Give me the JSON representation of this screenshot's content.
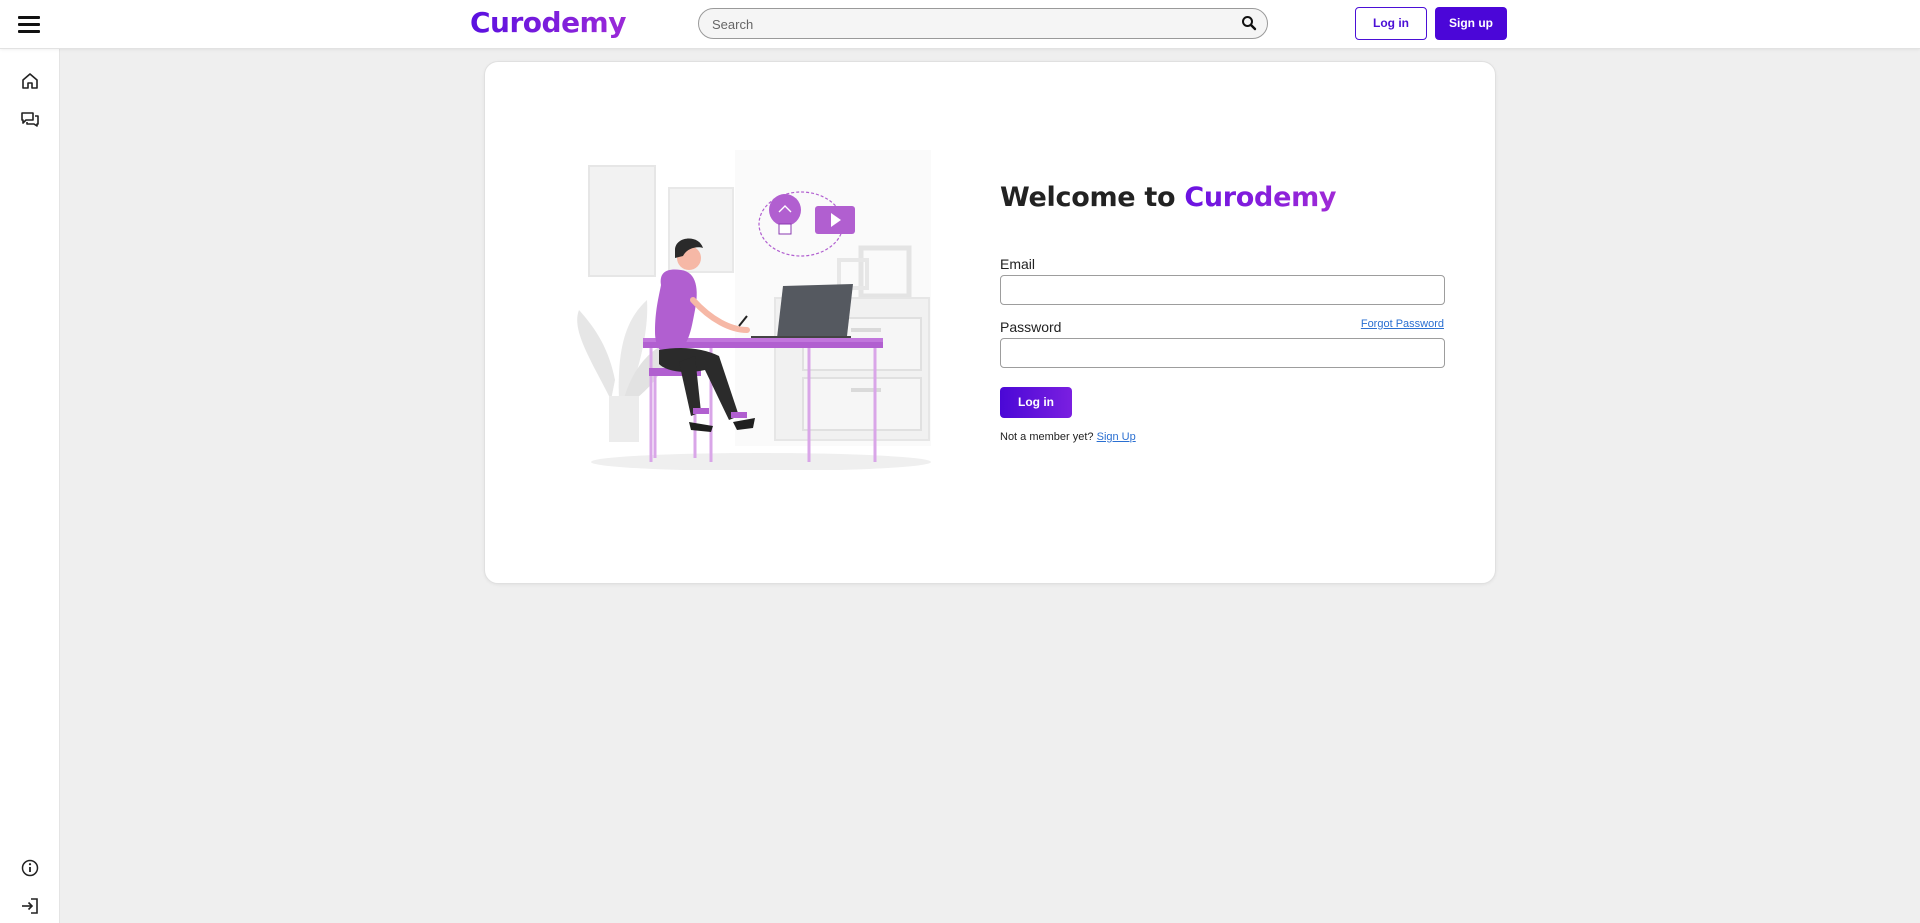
{
  "header": {
    "brand": "Curodemy",
    "search_placeholder": "Search",
    "search_value": "",
    "login_label": "Log in",
    "signup_label": "Sign up"
  },
  "sidebar": {
    "top_items": [
      {
        "icon": "home-icon"
      },
      {
        "icon": "chat-icon"
      }
    ],
    "bottom_items": [
      {
        "icon": "info-icon"
      },
      {
        "icon": "login-icon"
      }
    ]
  },
  "login_card": {
    "welcome_prefix": "Welcome to",
    "welcome_brand": "Curodemy",
    "email_label": "Email",
    "email_value": "",
    "password_label": "Password",
    "password_value": "",
    "forgot_label": "Forgot Password",
    "submit_label": "Log in",
    "member_prompt": "Not a member yet?",
    "signup_link": "Sign Up"
  },
  "colors": {
    "brand_primary": "#4b06d8",
    "brand_accent": "#8a24dc",
    "link": "#2a6fd1",
    "illustration_accent": "#b15fd0"
  }
}
